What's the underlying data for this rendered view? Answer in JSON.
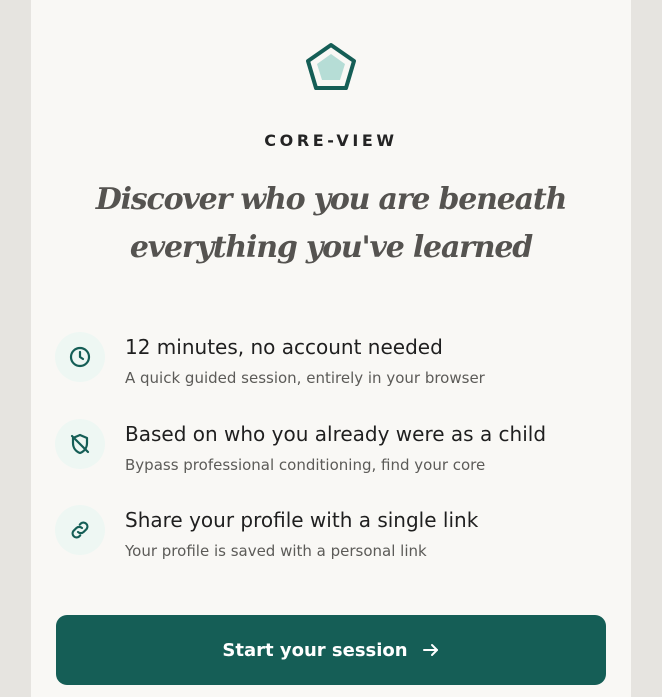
{
  "brand": {
    "name": "CORE-VIEW",
    "logo_icon": "pentagon-icon",
    "colors": {
      "accent": "#155e56",
      "accent_light": "#b6ddd6",
      "icon_bg": "#eef7f3"
    }
  },
  "headline": {
    "line1": "Discover who you are beneath",
    "line2": "everything you've learned"
  },
  "features": [
    {
      "icon": "clock-icon",
      "title": "12 minutes, no account needed",
      "subtitle": "A quick guided session, entirely in your browser"
    },
    {
      "icon": "shield-off-icon",
      "title": "Based on who you already were as a child",
      "subtitle": "Bypass professional conditioning, find your core"
    },
    {
      "icon": "link-icon",
      "title": "Share your profile with a single link",
      "subtitle": "Your profile is saved with a personal link"
    }
  ],
  "cta": {
    "label": "Start your session",
    "icon": "arrow-right-icon"
  }
}
